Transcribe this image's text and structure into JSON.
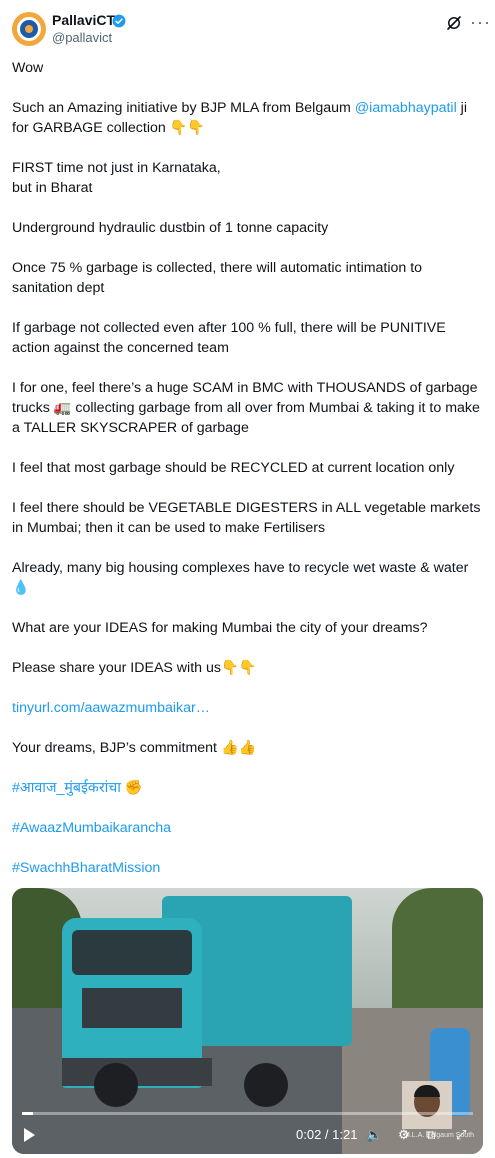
{
  "author": {
    "name": "PallaviCT",
    "handle": "@pallavict",
    "verified_color": "#1d9bf0"
  },
  "icons": {
    "grok": "grok-icon",
    "more": "more-icon",
    "more_glyph": "···"
  },
  "tweet": {
    "p1": "Wow",
    "p2_before": "Such an Amazing initiative by BJP MLA from Belgaum ",
    "p2_mention": "@iamabhaypatil",
    "p2_after": " ji for GARBAGE collection 👇👇",
    "p3": "FIRST time not just in Karnataka,\nbut in Bharat",
    "p4": "Underground hydraulic dustbin of 1 tonne capacity",
    "p5": "Once 75 % garbage is collected, there will automatic intimation to sanitation dept",
    "p6": "If garbage not collected even after 100 % full, there will be PUNITIVE action against the concerned team",
    "p7": "I for one, feel there’s a huge SCAM in BMC with THOUSANDS of garbage trucks 🚛 collecting garbage from all over from Mumbai & taking it to make a TALLER SKYSCRAPER of garbage",
    "p8": "I feel that most garbage should be RECYCLED at current location only",
    "p9": "I feel there should be VEGETABLE DIGESTERS in ALL vegetable markets in Mumbai; then it can be used to make Fertilisers",
    "p10": "Already, many big housing complexes have to recycle wet waste & water 💧",
    "p11": "What are your IDEAS for making Mumbai the city of your dreams?",
    "p12": "Please share your IDEAS with us👇👇",
    "link": "tinyurl.com/aawazmumbaikar…",
    "p13": "Your dreams, BJP’s commitment 👍👍",
    "hashtag1": "#आवाज_मुंबईकरांचा ✊",
    "hashtag2": "#AwaazMumbaikarancha",
    "hashtag3": "#SwachhBharatMission"
  },
  "video": {
    "time": "0:02 / 1:21",
    "progress": 0.025,
    "inset_caption": "M.L.A. Belgaum South"
  }
}
